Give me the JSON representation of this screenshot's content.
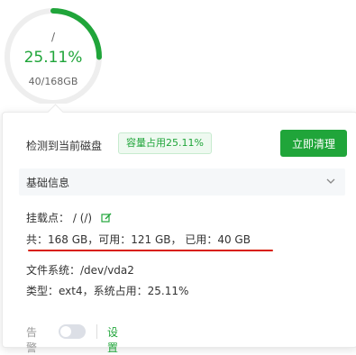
{
  "gauge": {
    "mount": "/",
    "percent_text": "25.11%",
    "capacity_text": "40/168GB",
    "fraction": 0.2511,
    "color": "#20a53a",
    "track_color": "#eeeeee"
  },
  "card": {
    "detected_label": "检测到当前磁盘",
    "usage_tag": "容量占用25.11%",
    "clean_button": "立即清理",
    "section_title": "基础信息",
    "mount_label": "挂载点：",
    "mount_value": "/ (/)",
    "summary": "共：168 GB，可用：121 GB， 已用：40 GB",
    "fs_label": "文件系统：",
    "fs_value": "/dev/vda2",
    "type_text": "类型：ext4，系统占用：25.11%",
    "alarm_label": "告警",
    "settings_link": "设置"
  },
  "colors": {
    "accent": "#20a53a",
    "annotation_red": "#d81e06"
  },
  "icons": [
    "chevron-down-icon",
    "edit-icon"
  ]
}
